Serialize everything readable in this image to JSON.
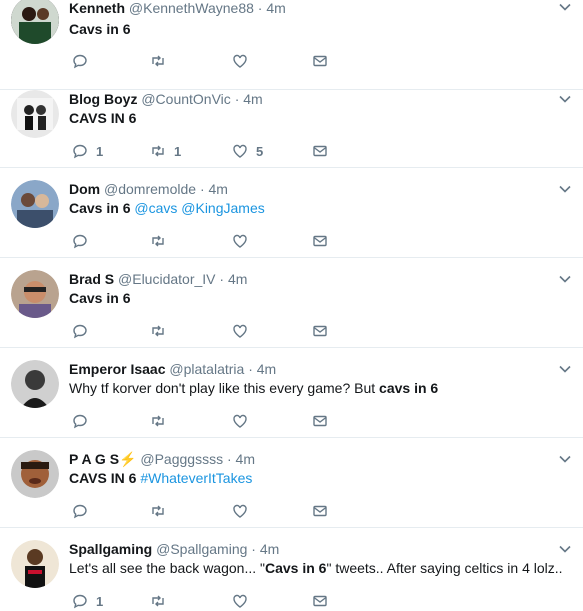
{
  "colors": {
    "link": "#1b95e0",
    "muted": "#657786",
    "divider": "#e6ecf0"
  },
  "tweets": [
    {
      "name": "Kenneth",
      "handle": "@KennethWayne88",
      "time": "4m",
      "text": [
        {
          "t": "Cavs in 6",
          "style": "bold"
        }
      ],
      "counts": {
        "reply": "",
        "retweet": "",
        "like": ""
      }
    },
    {
      "name": "Blog Boyz",
      "handle": "@CountOnVic",
      "time": "4m",
      "text": [
        {
          "t": "CAVS IN 6",
          "style": "bold"
        }
      ],
      "counts": {
        "reply": "1",
        "retweet": "1",
        "like": "5"
      }
    },
    {
      "name": "Dom",
      "handle": "@domremolde",
      "time": "4m",
      "text": [
        {
          "t": "Cavs in 6",
          "style": "bold"
        },
        {
          "t": " "
        },
        {
          "t": "@cavs",
          "style": "link"
        },
        {
          "t": " "
        },
        {
          "t": "@KingJames",
          "style": "link"
        }
      ],
      "counts": {
        "reply": "",
        "retweet": "",
        "like": ""
      }
    },
    {
      "name": "Brad S",
      "handle": "@Elucidator_IV",
      "time": "4m",
      "text": [
        {
          "t": "Cavs in 6",
          "style": "bold"
        }
      ],
      "counts": {
        "reply": "",
        "retweet": "",
        "like": ""
      }
    },
    {
      "name": "Emperor Isaac",
      "handle": "@platalatria",
      "time": "4m",
      "text": [
        {
          "t": "Why tf korver don't play like this every game? But "
        },
        {
          "t": "cavs in 6",
          "style": "bold"
        }
      ],
      "counts": {
        "reply": "",
        "retweet": "",
        "like": ""
      }
    },
    {
      "name": "P A G S⚡",
      "handle": "@Pagggssss",
      "time": "4m",
      "text": [
        {
          "t": "CAVS IN 6",
          "style": "bold"
        },
        {
          "t": " "
        },
        {
          "t": "#WhateverItTakes",
          "style": "link"
        }
      ],
      "counts": {
        "reply": "",
        "retweet": "",
        "like": ""
      }
    },
    {
      "name": "Spallgaming",
      "handle": "@Spallgaming",
      "time": "4m",
      "text": [
        {
          "t": "Let's all see the back wagon... \""
        },
        {
          "t": "Cavs in 6",
          "style": "bold"
        },
        {
          "t": "\" tweets.. After saying celtics in  4 lolz.."
        }
      ],
      "counts": {
        "reply": "1",
        "retweet": "",
        "like": ""
      }
    }
  ]
}
